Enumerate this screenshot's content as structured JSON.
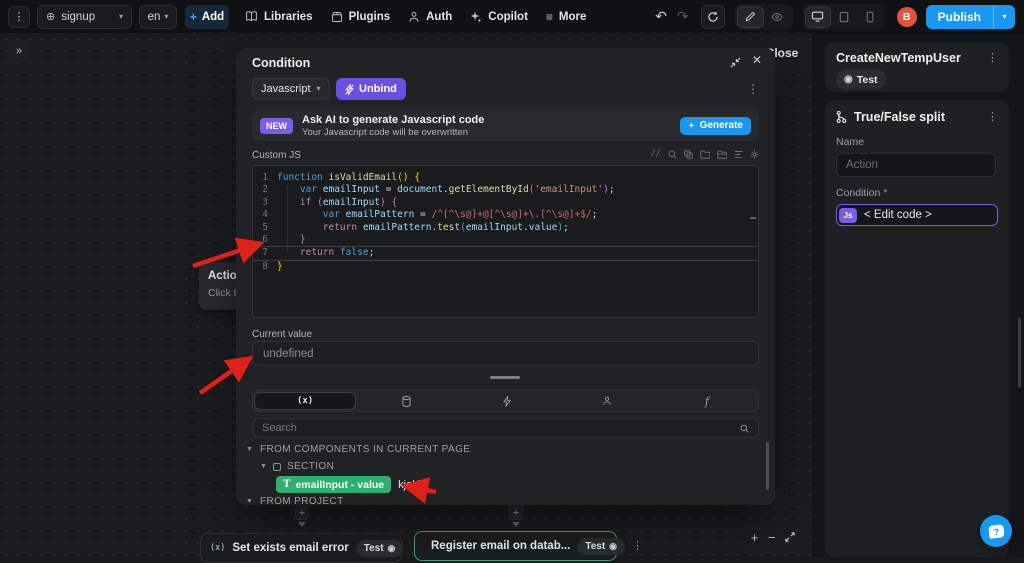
{
  "colors": {
    "accent_blue": "#1798f2",
    "accent_purple": "#6d52e8",
    "accent_green": "#2fae6c",
    "avatar_orange": "#e2533c",
    "annotation_red": "#e0211a"
  },
  "topbar": {
    "page_selector_value": "signup",
    "locale_value": "en",
    "add_label": "Add",
    "libraries_label": "Libraries",
    "plugins_label": "Plugins",
    "auth_label": "Auth",
    "copilot_label": "Copilot",
    "more_label": "More",
    "avatar_initial": "B",
    "publish_label": "Publish"
  },
  "canvas": {
    "sidebar_expand_glyph": "»",
    "close_label": "Close",
    "tooltip_title": "Action",
    "tooltip_subtitle": "Click to",
    "node1": {
      "icon_glyph": "(x)",
      "label": "Set exists email error",
      "badge": "Test"
    },
    "node2": {
      "label": "Register email on datab...",
      "badge": "Test"
    },
    "zoom_in": "+",
    "zoom_out": "−"
  },
  "modal": {
    "title": "Condition",
    "language_selector": "Javascript",
    "unbind_label": "Unbind",
    "ai_banner": {
      "badge": "NEW",
      "title": "Ask AI to generate Javascript code",
      "subtitle": "Your Javascript code will be overwritten",
      "generate_label": "Generate"
    },
    "editor_label": "Custom JS",
    "comment_glyph": "//",
    "code_lines": [
      {
        "tokens": [
          [
            "k",
            "function"
          ],
          [
            "p",
            " "
          ],
          [
            "f",
            "isValidEmail"
          ],
          [
            "y",
            "()"
          ],
          [
            "p",
            " "
          ],
          [
            "y",
            "{"
          ]
        ]
      },
      {
        "tokens": [
          [
            "p",
            "    "
          ],
          [
            "k",
            "var"
          ],
          [
            "p",
            " "
          ],
          [
            "v",
            "emailInput"
          ],
          [
            "p",
            " = "
          ],
          [
            "v",
            "document"
          ],
          [
            "p",
            "."
          ],
          [
            "f",
            "getElementById"
          ],
          [
            "m",
            "("
          ],
          [
            "s",
            "'emailInput'"
          ],
          [
            "m",
            ")"
          ],
          [
            "p",
            ";"
          ]
        ]
      },
      {
        "tokens": [
          [
            "p",
            "    "
          ],
          [
            "c",
            "if"
          ],
          [
            "p",
            " "
          ],
          [
            "m",
            "("
          ],
          [
            "v",
            "emailInput"
          ],
          [
            "m",
            ")"
          ],
          [
            "p",
            " "
          ],
          [
            "m",
            "{"
          ]
        ]
      },
      {
        "tokens": [
          [
            "p",
            "        "
          ],
          [
            "k",
            "var"
          ],
          [
            "p",
            " "
          ],
          [
            "v",
            "emailPattern"
          ],
          [
            "p",
            " = "
          ],
          [
            "r",
            "/^[^\\s@]+@[^\\s@]+\\.[^\\s@]+$/"
          ],
          [
            "p",
            ";"
          ]
        ]
      },
      {
        "tokens": [
          [
            "p",
            "        "
          ],
          [
            "c",
            "return"
          ],
          [
            "p",
            " "
          ],
          [
            "v",
            "emailPattern"
          ],
          [
            "p",
            "."
          ],
          [
            "f",
            "test"
          ],
          [
            "u",
            "("
          ],
          [
            "v",
            "emailInput"
          ],
          [
            "p",
            "."
          ],
          [
            "v",
            "value"
          ],
          [
            "u",
            ")"
          ],
          [
            "p",
            ";"
          ]
        ]
      },
      {
        "tokens": [
          [
            "p",
            "    "
          ],
          [
            "m",
            "}"
          ]
        ]
      },
      {
        "tokens": [
          [
            "p",
            "    "
          ],
          [
            "c",
            "return"
          ],
          [
            "p",
            " "
          ],
          [
            "k",
            "false"
          ],
          [
            "p",
            ";"
          ]
        ]
      },
      {
        "tokens": [
          [
            "y",
            "}"
          ]
        ]
      }
    ],
    "current_value_label": "Current value",
    "current_value": "undefined",
    "tab_variables_glyph": "(x)",
    "tab_formulas_glyph": "f",
    "search_placeholder": "Search",
    "tree": {
      "group_components": "FROM COMPONENTS IN CURRENT PAGE",
      "section_label": "SECTION",
      "pill_icon": "T",
      "pill_label": "emailInput - value",
      "pill_value": "kjokkj",
      "group_project": "FROM PROJECT"
    }
  },
  "panel": {
    "workflow_title": "CreateNewTempUser",
    "workflow_badge": "Test",
    "split_title": "True/False split",
    "name_label": "Name",
    "name_placeholder": "Action",
    "condition_label": "Condition *",
    "js_badge": "Js",
    "condition_value": "< Edit code >"
  }
}
